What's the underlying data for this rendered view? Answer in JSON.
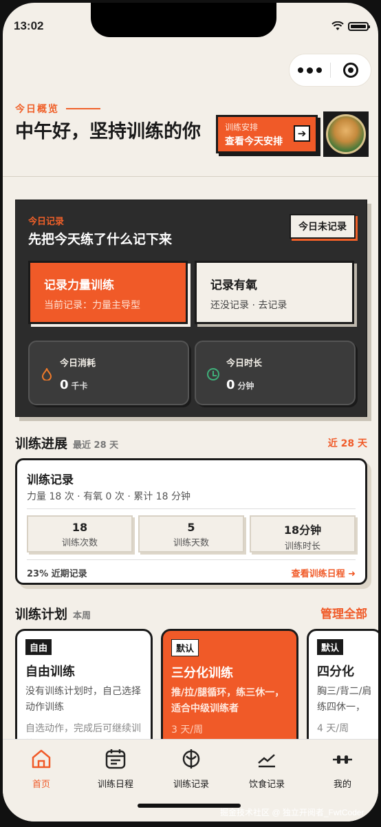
{
  "status_bar": {
    "time": "13:02"
  },
  "header": {
    "overview_label": "今日概览",
    "greeting": "中午好，坚持训练的你",
    "plan_button": {
      "small": "训练安排",
      "big": "查看今天安排",
      "arrow": "➔"
    }
  },
  "today_record": {
    "label": "今日记录",
    "title": "先把今天练了什么记下来",
    "status_button": "今日未记录",
    "options": [
      {
        "title": "记录力量训练",
        "subtitle": "当前记录：力量主导型"
      },
      {
        "title": "记录有氧",
        "subtitle": "还没记录 · 去记录"
      }
    ],
    "stats": [
      {
        "label": "今日消耗",
        "value": "0",
        "unit": "千卡",
        "icon": "flame-icon"
      },
      {
        "label": "今日时长",
        "value": "0",
        "unit": "分钟",
        "icon": "clock-icon"
      }
    ]
  },
  "progress": {
    "title": "训练进展",
    "subtitle": "最近 28 天",
    "right": "近 28 天",
    "card": {
      "title": "训练记录",
      "subtitle": "力量 18 次 · 有氧 0 次 · 累计 18 分钟",
      "boxes": [
        {
          "value": "18",
          "label": "训练次数"
        },
        {
          "value": "5",
          "label": "训练天数"
        },
        {
          "value": "18分钟",
          "label": "训练时长"
        }
      ],
      "footer_left": "23% 近期记录",
      "footer_right": "查看训练日程 ➜"
    }
  },
  "plans": {
    "title": "训练计划",
    "subtitle": "本周",
    "manage": "管理全部",
    "cards": [
      {
        "tag": "自由",
        "title": "自由训练",
        "desc": "没有训练计划时，自己选择动作训练",
        "extra": "自选动作，完成后可继续训练"
      },
      {
        "tag": "默认",
        "title": "三分化训练",
        "desc": "推/拉/腿循环，练三休一，适合中级训练者",
        "extra": "3 天/周"
      },
      {
        "tag": "默认",
        "title": "四分化",
        "desc": "胸三/背二/肩练四休一，",
        "extra": "4 天/周"
      }
    ]
  },
  "tabbar": [
    {
      "label": "首页",
      "icon": "home-icon",
      "active": true
    },
    {
      "label": "训练日程",
      "icon": "calendar-icon",
      "active": false
    },
    {
      "label": "训练记录",
      "icon": "record-icon",
      "active": false
    },
    {
      "label": "饮食记录",
      "icon": "trend-icon",
      "active": false
    },
    {
      "label": "我的",
      "icon": "profile-icon",
      "active": false
    }
  ],
  "watermark": "掘金技术社区 @ 独立开阅者_FwtCoder",
  "colors": {
    "accent": "#f05a28",
    "dark": "#2c2c2c",
    "background": "#f3efe8"
  }
}
